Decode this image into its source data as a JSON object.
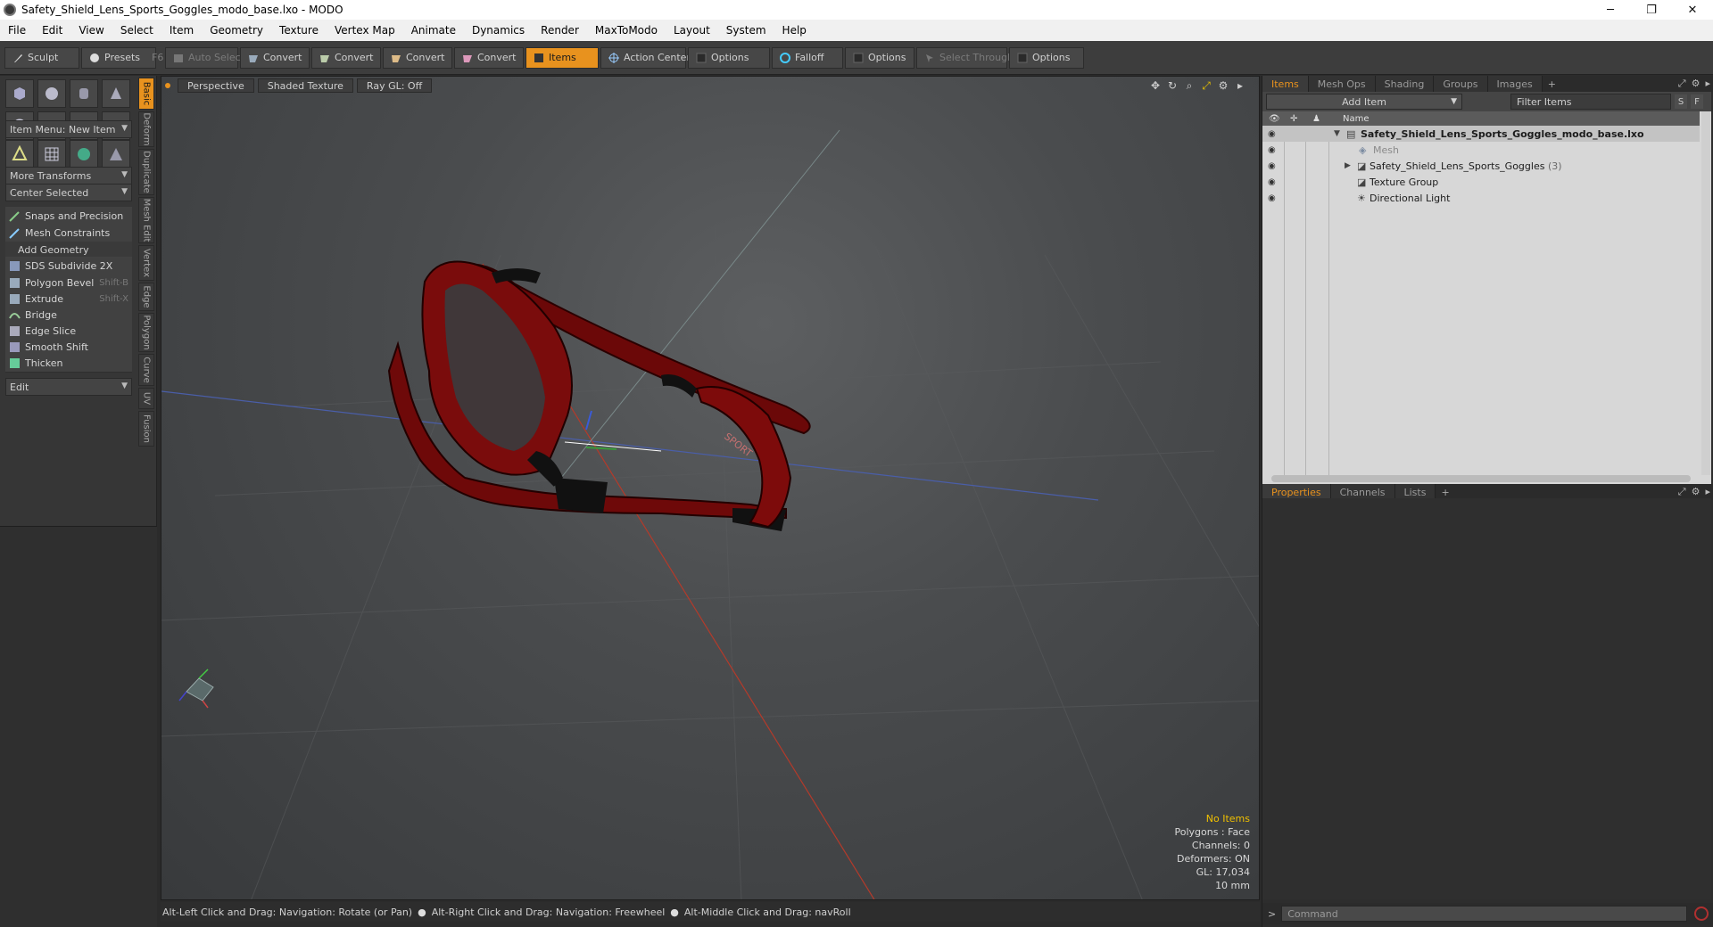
{
  "window": {
    "title": "Safety_Shield_Lens_Sports_Goggles_modo_base.lxo - MODO",
    "minimize": "─",
    "maximize": "❐",
    "close": "✕"
  },
  "menu": [
    "File",
    "Edit",
    "View",
    "Select",
    "Item",
    "Geometry",
    "Texture",
    "Vertex Map",
    "Animate",
    "Dynamics",
    "Render",
    "MaxToModo",
    "Layout",
    "System",
    "Help"
  ],
  "toolbar": {
    "sculpt": "Sculpt",
    "presets": "Presets",
    "presets_shortcut": "F6",
    "auto_select": "Auto Select",
    "convert1": "Convert",
    "convert2": "Convert",
    "convert3": "Convert",
    "convert4": "Convert",
    "items": "Items",
    "action_center": "Action Center",
    "options1": "Options",
    "falloff": "Falloff",
    "options2": "Options",
    "select_through": "Select Through",
    "options3": "Options"
  },
  "left_panel": {
    "item_menu": "Item Menu: New Item",
    "more_transforms": "More Transforms",
    "center_selected": "Center Selected",
    "snaps": "Snaps and Precision",
    "mesh_constraints": "Mesh Constraints",
    "add_geometry": "Add Geometry",
    "tools": [
      {
        "label": "SDS Subdivide 2X",
        "shortcut": ""
      },
      {
        "label": "Polygon Bevel",
        "shortcut": "Shift-B"
      },
      {
        "label": "Extrude",
        "shortcut": "Shift-X"
      },
      {
        "label": "Bridge",
        "shortcut": ""
      },
      {
        "label": "Edge Slice",
        "shortcut": ""
      },
      {
        "label": "Smooth Shift",
        "shortcut": ""
      },
      {
        "label": "Thicken",
        "shortcut": ""
      }
    ],
    "edit": "Edit",
    "vtabs": [
      "Basic",
      "Deform",
      "Duplicate",
      "Mesh Edit",
      "Vertex",
      "Edge",
      "Polygon",
      "Curve",
      "UV",
      "Fusion"
    ]
  },
  "viewport": {
    "view": "Perspective",
    "shading": "Shaded Texture",
    "raygl": "Ray GL: Off",
    "model_text": "SPORT",
    "stats": {
      "selection": "No Items",
      "polygons": "Polygons : Face",
      "channels": "Channels: 0",
      "deformers": "Deformers: ON",
      "gl": "GL: 17,034",
      "scale": "10 mm"
    },
    "colors": {
      "model": "#7a0c0c",
      "accent": "#e8921e"
    }
  },
  "statusbar": {
    "hint1": "Alt-Left Click and Drag: Navigation: Rotate (or Pan)",
    "hint2": "Alt-Right Click and Drag: Navigation: Freewheel",
    "hint3": "Alt-Middle Click and Drag: navRoll"
  },
  "right_panel": {
    "tabs": [
      "Items",
      "Mesh Ops",
      "Shading",
      "Groups",
      "Images"
    ],
    "add_item": "Add Item",
    "filter_placeholder": "Filter Items",
    "s_btn": "S",
    "f_btn": "F",
    "col_name": "Name",
    "tree": [
      {
        "label": "Safety_Shield_Lens_Sports_Goggles_modo_base.lxo",
        "count": ""
      },
      {
        "label": "Mesh",
        "count": ""
      },
      {
        "label": "Safety_Shield_Lens_Sports_Goggles",
        "count": "(3)"
      },
      {
        "label": "Texture Group",
        "count": ""
      },
      {
        "label": "Directional Light",
        "count": ""
      }
    ],
    "lower_tabs": [
      "Properties",
      "Channels",
      "Lists"
    ],
    "command_placeholder": "Command",
    "prompt": ">"
  }
}
